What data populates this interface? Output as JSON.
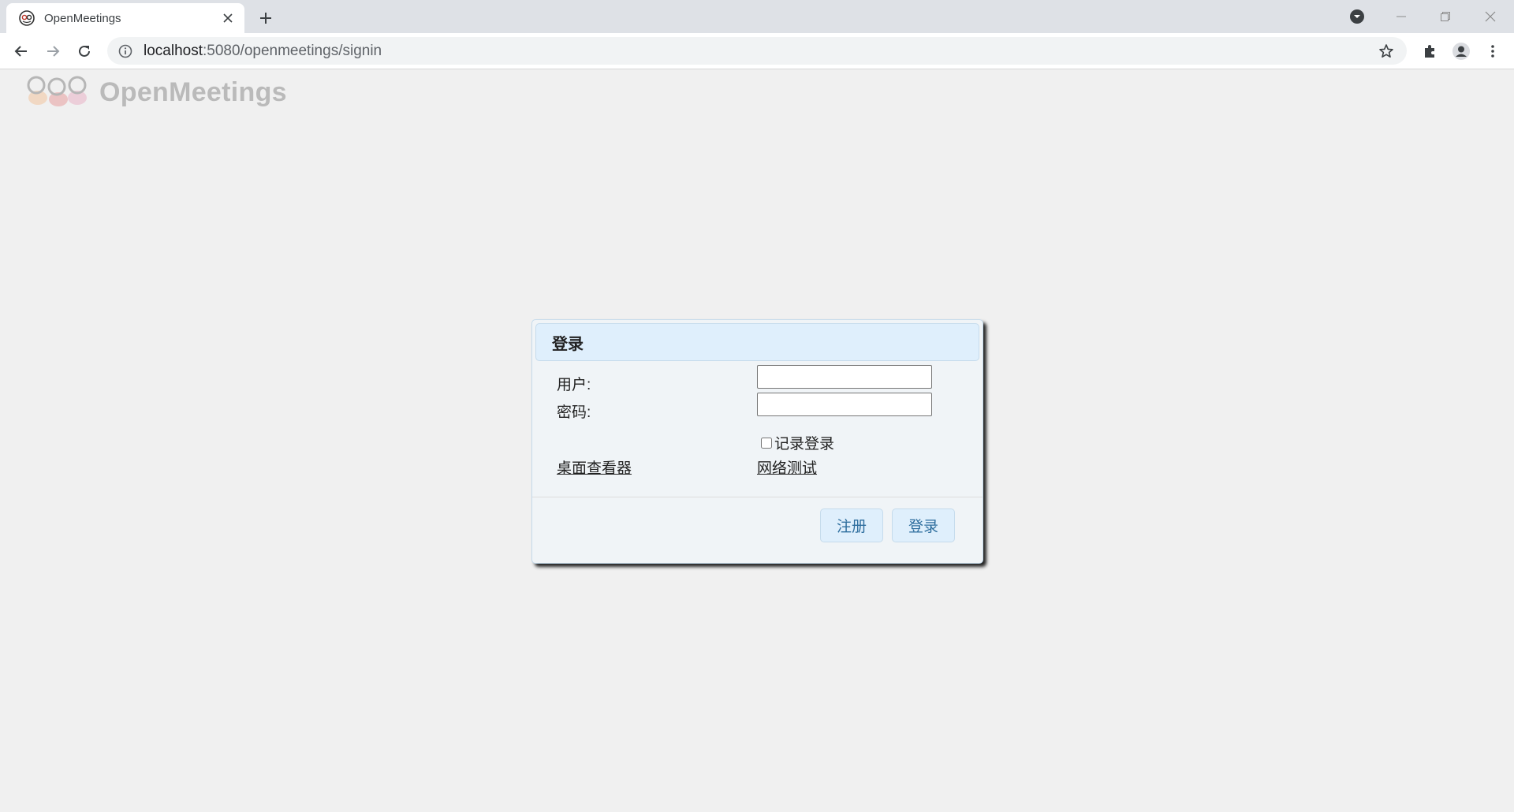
{
  "browser": {
    "tab_title": "OpenMeetings",
    "url_host": "localhost",
    "url_path": ":5080/openmeetings/signin"
  },
  "page": {
    "logo_text": "OpenMeetings"
  },
  "dialog": {
    "title": "登录",
    "user_label": "用户:",
    "user_value": "",
    "password_label": "密码:",
    "password_value": "",
    "remember_label": "记录登录",
    "remember_checked": false,
    "desktop_viewer_link": "桌面查看器",
    "network_test_link": "网络测试",
    "register_button": "注册",
    "login_button": "登录"
  },
  "colors": {
    "page_bg": "#f0f0f0",
    "dialog_bg": "#f0f4f7",
    "titlebar_bg": "#dfeffc",
    "button_text": "#2e6e9e"
  }
}
